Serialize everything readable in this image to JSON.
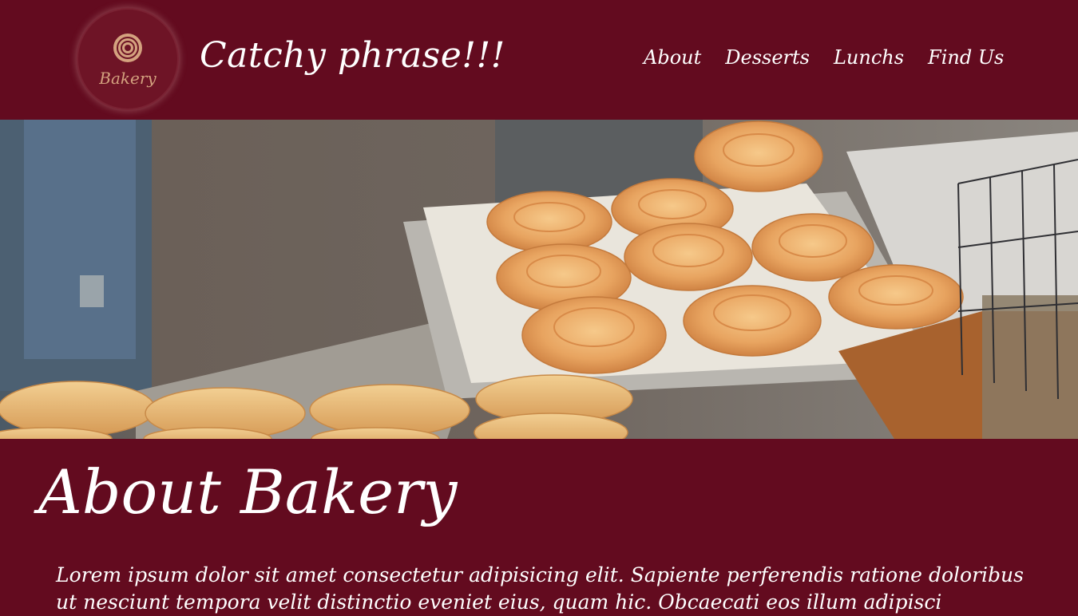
{
  "header": {
    "logo_text": "Bakery",
    "catchphrase": "Catchy phrase!!!"
  },
  "nav": {
    "items": [
      {
        "label": "About"
      },
      {
        "label": "Desserts"
      },
      {
        "label": "Lunchs"
      },
      {
        "label": "Find Us"
      }
    ]
  },
  "hero": {
    "image": "bakery-photo"
  },
  "about": {
    "title": "About Bakery",
    "body": "Lorem ipsum dolor sit amet consectetur adipisicing elit. Sapiente perferendis ratione doloribus ut nesciunt tempora velit distinctio eveniet eius, quam hic. Obcaecati eos illum adipisci"
  },
  "colors": {
    "brand": "#630b1f",
    "text": "#ffffff",
    "logo_accent": "#d4a27f"
  }
}
